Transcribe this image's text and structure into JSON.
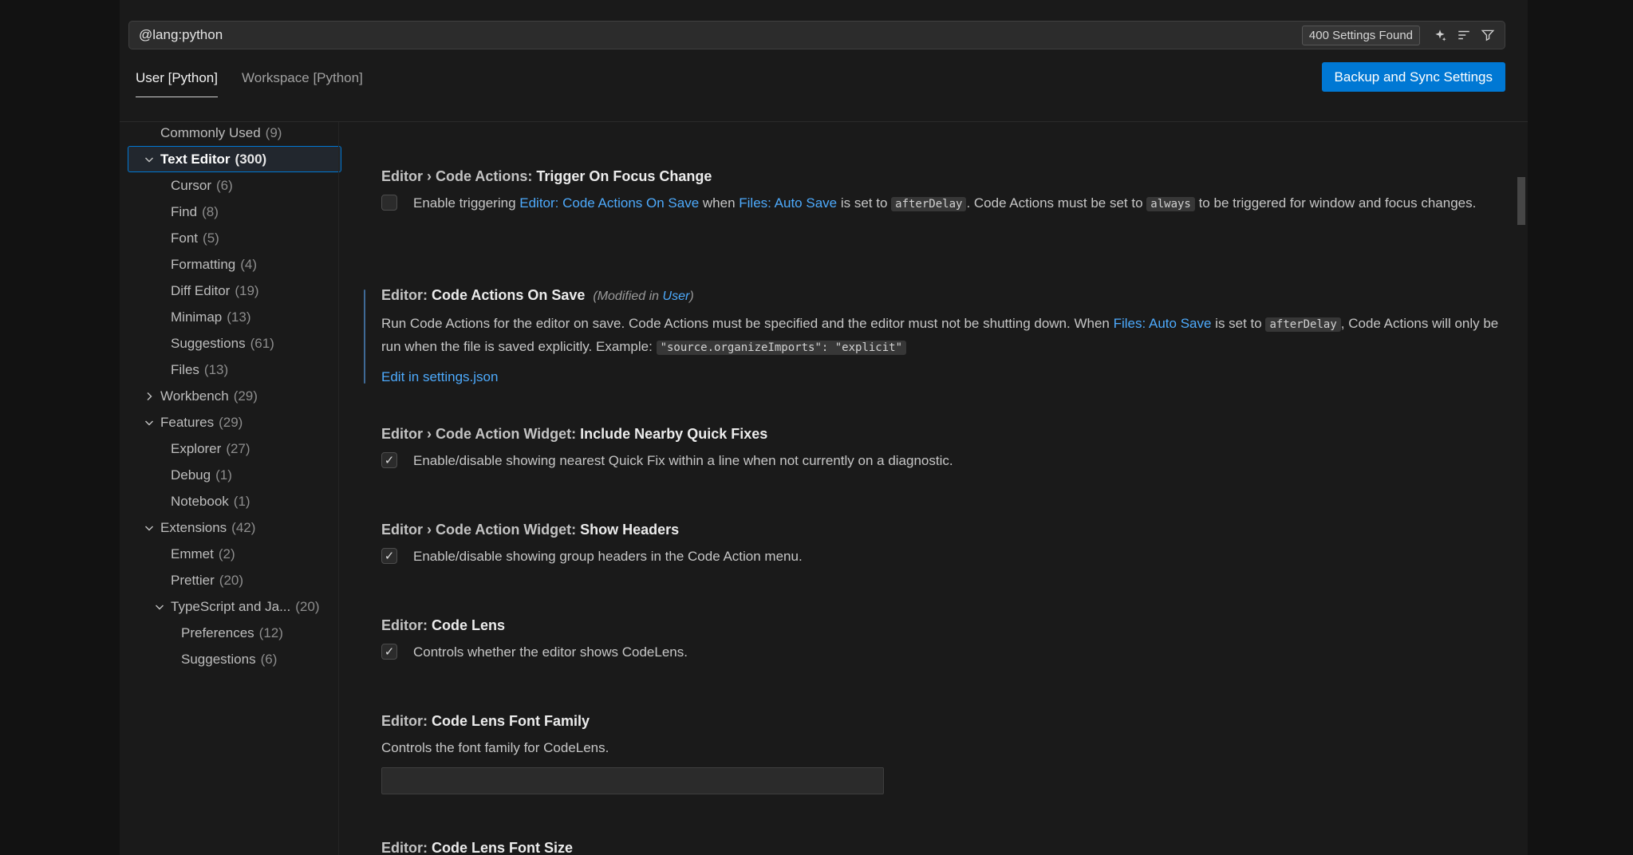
{
  "search": {
    "query": "@lang:python",
    "results_badge": "400 Settings Found"
  },
  "tabs": [
    {
      "label": "User [Python]"
    },
    {
      "label": "Workspace [Python]"
    }
  ],
  "header": {
    "backup_sync_label": "Backup and Sync Settings"
  },
  "toc": {
    "items": [
      {
        "label": "Commonly Used",
        "count": "9",
        "indent": 0,
        "chevron": null,
        "selected": false
      },
      {
        "label": "Text Editor",
        "count": "300",
        "indent": 0,
        "chevron": "down",
        "selected": true
      },
      {
        "label": "Cursor",
        "count": "6",
        "indent": 1,
        "chevron": null,
        "selected": false
      },
      {
        "label": "Find",
        "count": "8",
        "indent": 1,
        "chevron": null,
        "selected": false
      },
      {
        "label": "Font",
        "count": "5",
        "indent": 1,
        "chevron": null,
        "selected": false
      },
      {
        "label": "Formatting",
        "count": "4",
        "indent": 1,
        "chevron": null,
        "selected": false
      },
      {
        "label": "Diff Editor",
        "count": "19",
        "indent": 1,
        "chevron": null,
        "selected": false
      },
      {
        "label": "Minimap",
        "count": "13",
        "indent": 1,
        "chevron": null,
        "selected": false
      },
      {
        "label": "Suggestions",
        "count": "61",
        "indent": 1,
        "chevron": null,
        "selected": false
      },
      {
        "label": "Files",
        "count": "13",
        "indent": 1,
        "chevron": null,
        "selected": false
      },
      {
        "label": "Workbench",
        "count": "29",
        "indent": 0,
        "chevron": "right",
        "selected": false
      },
      {
        "label": "Features",
        "count": "29",
        "indent": 0,
        "chevron": "down",
        "selected": false
      },
      {
        "label": "Explorer",
        "count": "27",
        "indent": 1,
        "chevron": null,
        "selected": false
      },
      {
        "label": "Debug",
        "count": "1",
        "indent": 1,
        "chevron": null,
        "selected": false
      },
      {
        "label": "Notebook",
        "count": "1",
        "indent": 1,
        "chevron": null,
        "selected": false
      },
      {
        "label": "Extensions",
        "count": "42",
        "indent": 0,
        "chevron": "down",
        "selected": false
      },
      {
        "label": "Emmet",
        "count": "2",
        "indent": 1,
        "chevron": null,
        "selected": false
      },
      {
        "label": "Prettier",
        "count": "20",
        "indent": 1,
        "chevron": null,
        "selected": false
      },
      {
        "label": "TypeScript and Ja...",
        "count": "20",
        "indent": 1,
        "chevron": "down",
        "selected": false
      },
      {
        "label": "Preferences",
        "count": "12",
        "indent": 2,
        "chevron": null,
        "selected": false
      },
      {
        "label": "Suggestions",
        "count": "6",
        "indent": 2,
        "chevron": null,
        "selected": false
      }
    ]
  },
  "settings": [
    {
      "id": "trigger-on-focus-change",
      "category": "Editor › Code Actions:",
      "name": "Trigger On Focus Change",
      "type": "checkbox",
      "checked": false,
      "description": [
        {
          "t": "text",
          "v": "Enable triggering "
        },
        {
          "t": "link",
          "v": "Editor: Code Actions On Save"
        },
        {
          "t": "text",
          "v": " when "
        },
        {
          "t": "link",
          "v": "Files: Auto Save"
        },
        {
          "t": "text",
          "v": " is set to "
        },
        {
          "t": "code",
          "v": "afterDelay"
        },
        {
          "t": "text",
          "v": ". Code Actions must be set to "
        },
        {
          "t": "code",
          "v": "always"
        },
        {
          "t": "text",
          "v": " to be triggered for window and focus changes."
        }
      ]
    },
    {
      "id": "code-actions-on-save",
      "category": "Editor:",
      "name": "Code Actions On Save",
      "type": "json",
      "modified": true,
      "modified_note": [
        {
          "t": "text",
          "v": "(Modified in "
        },
        {
          "t": "link",
          "v": "User"
        },
        {
          "t": "text",
          "v": ")"
        }
      ],
      "description": [
        {
          "t": "text",
          "v": "Run Code Actions for the editor on save. Code Actions must be specified and the editor must not be shutting down. When "
        },
        {
          "t": "link",
          "v": "Files: Auto Save"
        },
        {
          "t": "text",
          "v": " is set to "
        },
        {
          "t": "code",
          "v": "afterDelay"
        },
        {
          "t": "text",
          "v": ", Code Actions will only be run when the file is saved explicitly. Example: "
        },
        {
          "t": "code",
          "v": "\"source.organizeImports\": \"explicit\""
        }
      ],
      "link_label": "Edit in settings.json"
    },
    {
      "id": "include-nearby-quick-fixes",
      "category": "Editor › Code Action Widget:",
      "name": "Include Nearby Quick Fixes",
      "type": "checkbox",
      "checked": true,
      "description": [
        {
          "t": "text",
          "v": "Enable/disable showing nearest Quick Fix within a line when not currently on a diagnostic."
        }
      ]
    },
    {
      "id": "show-headers",
      "category": "Editor › Code Action Widget:",
      "name": "Show Headers",
      "type": "checkbox",
      "checked": true,
      "description": [
        {
          "t": "text",
          "v": "Enable/disable showing group headers in the Code Action menu."
        }
      ]
    },
    {
      "id": "code-lens",
      "category": "Editor:",
      "name": "Code Lens",
      "type": "checkbox",
      "checked": true,
      "description": [
        {
          "t": "text",
          "v": "Controls whether the editor shows CodeLens."
        }
      ]
    },
    {
      "id": "code-lens-font-family",
      "category": "Editor:",
      "name": "Code Lens Font Family",
      "type": "input",
      "value": "",
      "description": [
        {
          "t": "text",
          "v": "Controls the font family for CodeLens."
        }
      ]
    },
    {
      "id": "code-lens-font-size",
      "category": "Editor:",
      "name": "Code Lens Font Size",
      "type": "title-only",
      "description": []
    }
  ]
}
